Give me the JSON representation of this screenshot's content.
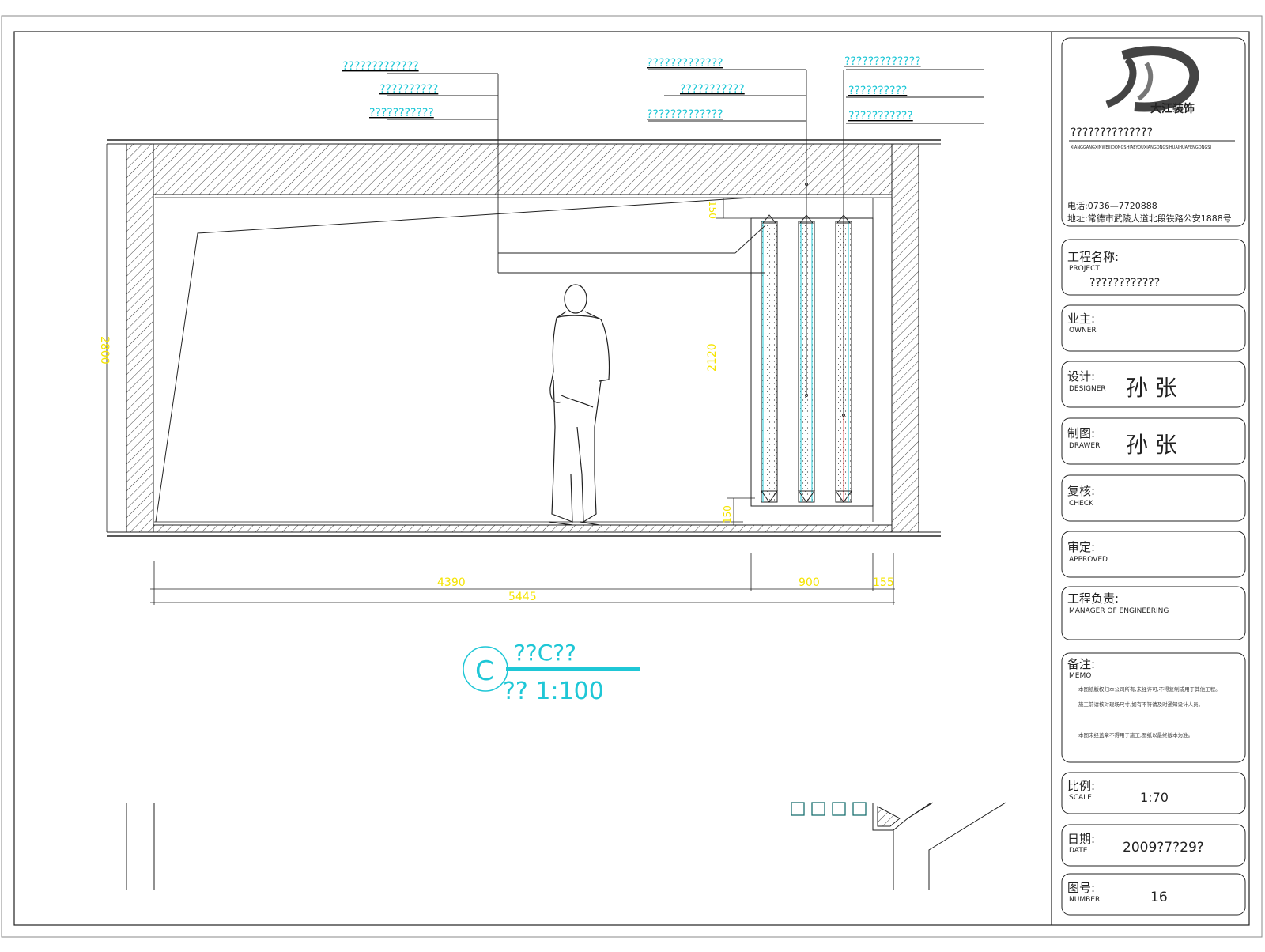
{
  "callouts": {
    "left": [
      "?????????????",
      "??????????",
      "???????????"
    ],
    "middle": [
      "?????????????",
      "???????????",
      "?????????????"
    ],
    "right": [
      "?????????????",
      "??????????",
      "???????????"
    ]
  },
  "dimensions": {
    "height_left": "2800",
    "top_offset": "150",
    "panel_height": "2120",
    "bottom_offset": "150",
    "width_a": "4390",
    "width_b": "900",
    "width_c": "155",
    "total_width": "5445"
  },
  "view_label": {
    "symbol": "C",
    "title": "??C??",
    "scale": "?? 1:100"
  },
  "legend_squares": 4,
  "title_block": {
    "company_name": "??????????????",
    "company_sub": "XIANGGANGXINWEIJIDONGSHIAEYOUXIANGONGSIHUAIHUAFENGONGSI",
    "phone": "电话:0736—7720888",
    "address": "地址:常德市武陵大道北段铁路公安1888号",
    "project_label_cn": "工程名称:",
    "project_label_en": "PROJECT",
    "project_value": "????????????",
    "owner_label_cn": "业主:",
    "owner_label_en": "OWNER",
    "designer_label_cn": "设计:",
    "designer_label_en": "DESIGNER",
    "designer_value": "孙 张",
    "drawer_label_cn": "制图:",
    "drawer_label_en": "DRAWER",
    "drawer_value": "孙 张",
    "check_label_cn": "复核:",
    "check_label_en": "CHECK",
    "approved_label_cn": "审定:",
    "approved_label_en": "APPROVED",
    "manager_label_cn": "工程负责:",
    "manager_label_en": "MANAGER OF ENGINEERING",
    "memo_label_cn": "备注:",
    "memo_label_en": "MEMO",
    "memo_line1": "本图纸版权归本公司所有,未经许可,不得复制或用于其他工程。",
    "memo_line2": "施工前请核对现场尺寸,如有不符请及时通知设计人员。",
    "memo_line3": "本图未经盖章不得用于施工,图纸以最终版本为准。",
    "scale_label_cn": "比例:",
    "scale_label_en": "SCALE",
    "scale_value": "1:70",
    "date_label_cn": "日期:",
    "date_label_en": "DATE",
    "date_value": "2009?7?29?",
    "number_label_cn": "图号:",
    "number_label_en": "NUMBER",
    "number_value": "16"
  },
  "colors": {
    "cyan": "#1fc7d6",
    "yellow": "#f5e400",
    "line": "#222222"
  }
}
